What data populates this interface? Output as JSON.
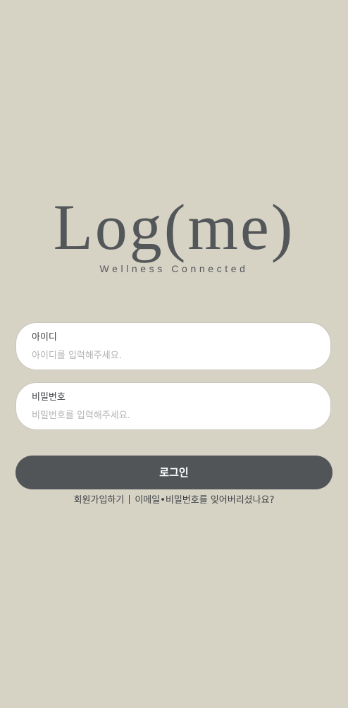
{
  "brand": {
    "logo_text": "Log(me)",
    "tagline": "Wellness Connected"
  },
  "login_form": {
    "id_field": {
      "label": "아이디",
      "placeholder": "아이디를 입력해주세요.",
      "value": ""
    },
    "password_field": {
      "label": "비밀번호",
      "placeholder": "비밀번호를 입력해주세요.",
      "value": ""
    },
    "login_button_label": "로그인"
  },
  "footer_links": {
    "signup_label": "회원가입하기",
    "forgot_label": "이메일•비밀번호를 잊어버리셨나요?"
  },
  "colors": {
    "background": "#d6d3c5",
    "brand_gray": "#54575a",
    "button_bg": "#525558",
    "field_bg": "#ffffff",
    "placeholder": "#b3b3b3"
  }
}
